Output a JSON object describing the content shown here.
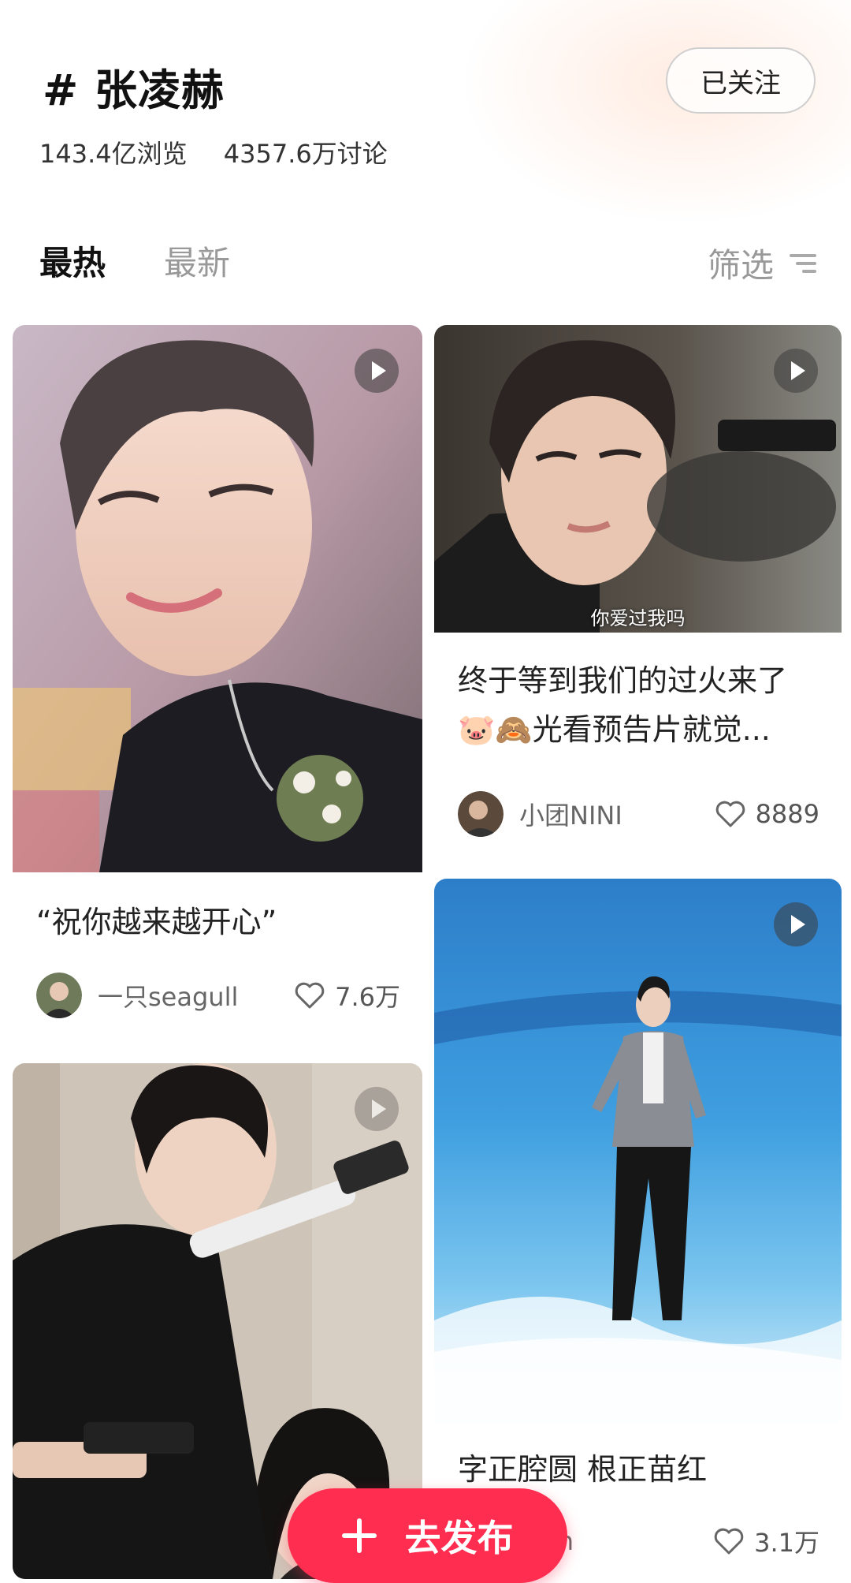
{
  "topic": {
    "title": "# 张凌赫",
    "follow_label": "已关注",
    "views": "143.4亿浏览",
    "discussions": "4357.6万讨论"
  },
  "tabs": {
    "hot": "最热",
    "new": "最新",
    "filter": "筛选"
  },
  "posts": [
    {
      "title": "“祝你越来越开心”",
      "author": "一只seagull",
      "likes": "7.6万",
      "is_video": true
    },
    {
      "title": "终于等到我们的过火来了🐷🙈光看预告片就觉...",
      "caption": "你爱过我吗",
      "author": "小团NINI",
      "likes": "8889",
      "is_video": true
    },
    {
      "title": "",
      "author": "",
      "likes": "",
      "is_video": true
    },
    {
      "title": "字正腔圆 根正苗红",
      "author": "z-0h",
      "likes": "3.1万",
      "is_video": true
    }
  ],
  "publish_label": "去发布",
  "colors": {
    "accent": "#ff2d4f",
    "tab_inactive": "#999999"
  }
}
